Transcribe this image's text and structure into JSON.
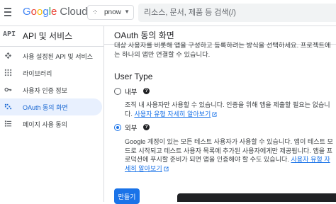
{
  "topbar": {
    "logo": {
      "g": "G",
      "o1": "o",
      "o2": "o",
      "g2": "g",
      "l": "l",
      "e": "e",
      "product": "Cloud"
    },
    "project_name": "pnow",
    "search_placeholder": "리소스, 문서, 제품 등 검색(/)"
  },
  "sidebar": {
    "api_badge": "API",
    "title": "API 및 서비스",
    "items": [
      {
        "label": "사용 설정된 API 및 서비스",
        "icon": "api-diamond-icon"
      },
      {
        "label": "라이브러리",
        "icon": "library-grid-icon"
      },
      {
        "label": "사용자 인증 정보",
        "icon": "key-icon"
      },
      {
        "label": "OAuth 동의 화면",
        "icon": "consent-screen-icon"
      },
      {
        "label": "페이지 사용 동의",
        "icon": "page-agreement-icon"
      }
    ],
    "active_index": 3
  },
  "main": {
    "title": "OAuth 동의 화면",
    "description": "대상 사용자를 비롯해 앱을 구성하고 등록하려는 방식을 선택하세요. 프로젝트에는 하나의 앱만 연결할 수 있습니다.",
    "user_type_heading": "User Type",
    "options": [
      {
        "label": "내부",
        "selected": false,
        "description": "조직 내 사용자만 사용할 수 있습니다. 인증을 위해 앱을 제출할 필요는 없습니다.",
        "link": "사용자 유형 자세히 알아보기"
      },
      {
        "label": "외부",
        "selected": true,
        "description": "Google 계정이 있는 모든 테스트 사용자가 사용할 수 있습니다. 앱이 테스트 모드로 시작되고 테스트 사용자 목록에 추가된 사용자에게만 제공됩니다. 앱을 프로덕션에 푸시할 준비가 되면 앱을 인증해야 할 수도 있습니다.",
        "link": "사용자 유형 자세히 알아보기"
      }
    ],
    "create_button": "만들기"
  },
  "colors": {
    "accent": "#1a73e8",
    "active_bg": "#e8f0fe",
    "active_text": "#1967d2"
  }
}
